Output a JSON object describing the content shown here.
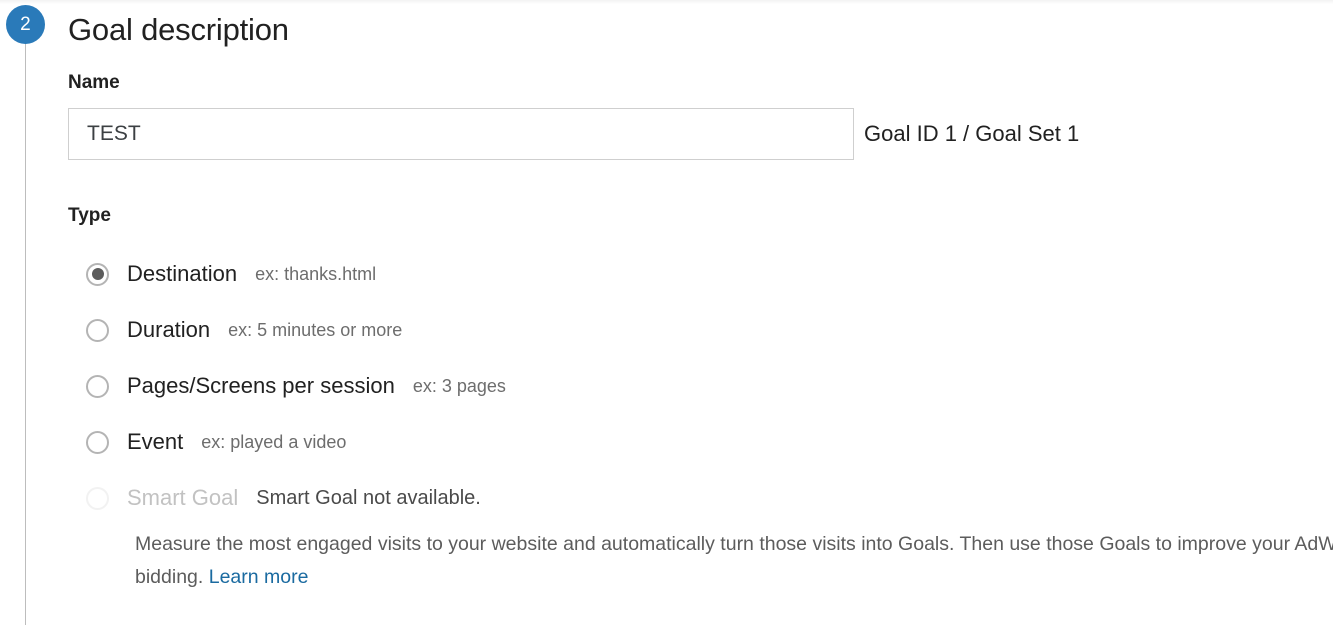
{
  "step": {
    "number": "2",
    "badge_color": "#2a7ab9"
  },
  "section": {
    "title": "Goal description"
  },
  "name_field": {
    "label": "Name",
    "value": "TEST",
    "placeholder": "",
    "goal_id_text": "Goal ID 1 / Goal Set 1"
  },
  "type_section": {
    "label": "Type",
    "options": [
      {
        "label": "Destination",
        "example": "ex: thanks.html",
        "selected": true,
        "disabled": false
      },
      {
        "label": "Duration",
        "example": "ex: 5 minutes or more",
        "selected": false,
        "disabled": false
      },
      {
        "label": "Pages/Screens per session",
        "example": "ex: 3 pages",
        "selected": false,
        "disabled": false
      },
      {
        "label": "Event",
        "example": "ex: played a video",
        "selected": false,
        "disabled": false
      },
      {
        "label": "Smart Goal",
        "example": "Smart Goal not available.",
        "selected": false,
        "disabled": true
      }
    ]
  },
  "smart_goal_description": {
    "text": "Measure the most engaged visits to your website and automatically turn those visits into Goals. Then use those Goals to improve your AdWords bidding.",
    "link_label": "Learn more",
    "link_color": "#1a6aa0"
  }
}
